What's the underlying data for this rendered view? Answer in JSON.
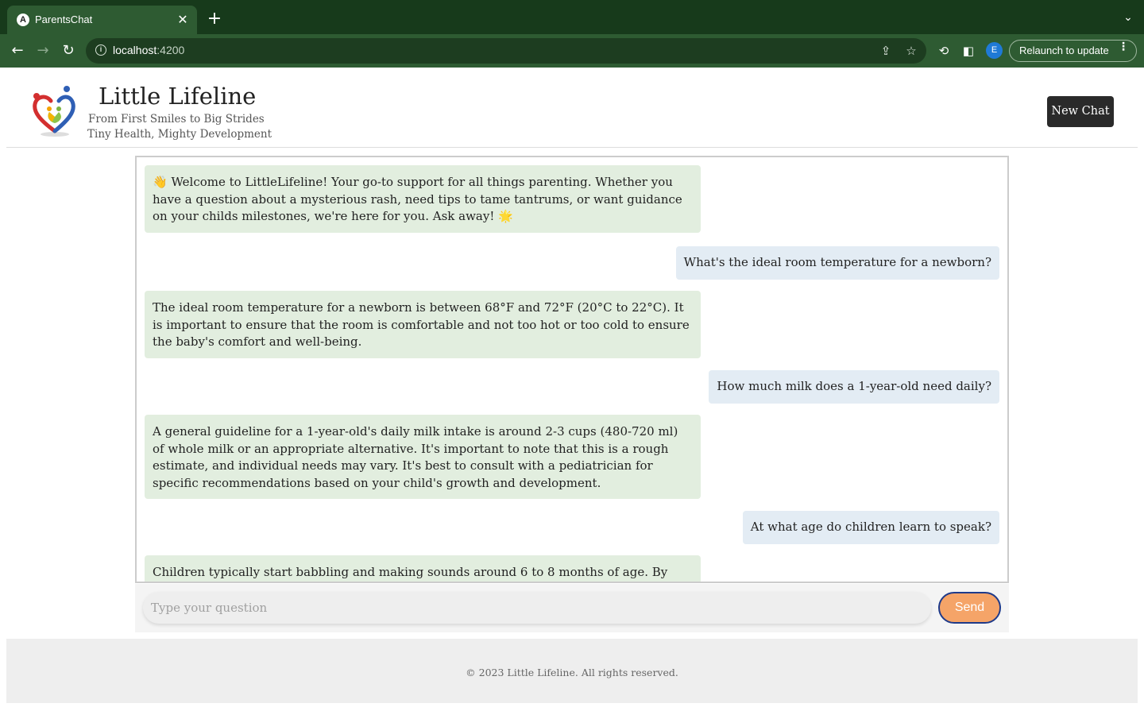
{
  "browser": {
    "tab_title": "ParentsChat",
    "tab_favicon_letter": "A",
    "url_host": "localhost",
    "url_port": ":4200",
    "profile_initial": "E",
    "relaunch_label": "Relaunch to update",
    "theme_color": "#2e5b32"
  },
  "header": {
    "title": "Little Lifeline",
    "tagline_1": "From First Smiles to Big Strides",
    "tagline_2": "Tiny Health, Mighty Development",
    "new_chat_label": "New Chat"
  },
  "messages": [
    {
      "role": "bot",
      "text": "👋 Welcome to LittleLifeline! Your go-to support for all things parenting. Whether you have a question about a mysterious rash, need tips to tame tantrums, or want guidance on your childs milestones, we're here for you. Ask away! 🌟"
    },
    {
      "role": "user",
      "text": "What's the ideal room temperature for a newborn?"
    },
    {
      "role": "bot",
      "text": "The ideal room temperature for a newborn is between 68°F and 72°F (20°C to 22°C). It is important to ensure that the room is comfortable and not too hot or too cold to ensure the baby's comfort and well-being."
    },
    {
      "role": "user",
      "text": "How much milk does a 1-year-old need daily?"
    },
    {
      "role": "bot",
      "text": "A general guideline for a 1-year-old's daily milk intake is around 2-3 cups (480-720 ml) of whole milk or an appropriate alternative. It's important to note that this is a rough estimate, and individual needs may vary. It's best to consult with a pediatrician for specific recommendations based on your child's growth and development."
    },
    {
      "role": "user",
      "text": "At what age do children learn to speak?"
    },
    {
      "role": "bot",
      "text": "Children typically start babbling and making sounds around 6 to 8 months of age. By their first"
    }
  ],
  "input": {
    "placeholder": "Type your question",
    "value": "",
    "send_label": "Send"
  },
  "footer": {
    "text": "© 2023 Little Lifeline. All rights reserved."
  },
  "colors": {
    "bot_bubble": "#e2eedf",
    "user_bubble": "#e3ecf4",
    "send_button": "#f5a468",
    "send_border": "#1e3a8a"
  }
}
